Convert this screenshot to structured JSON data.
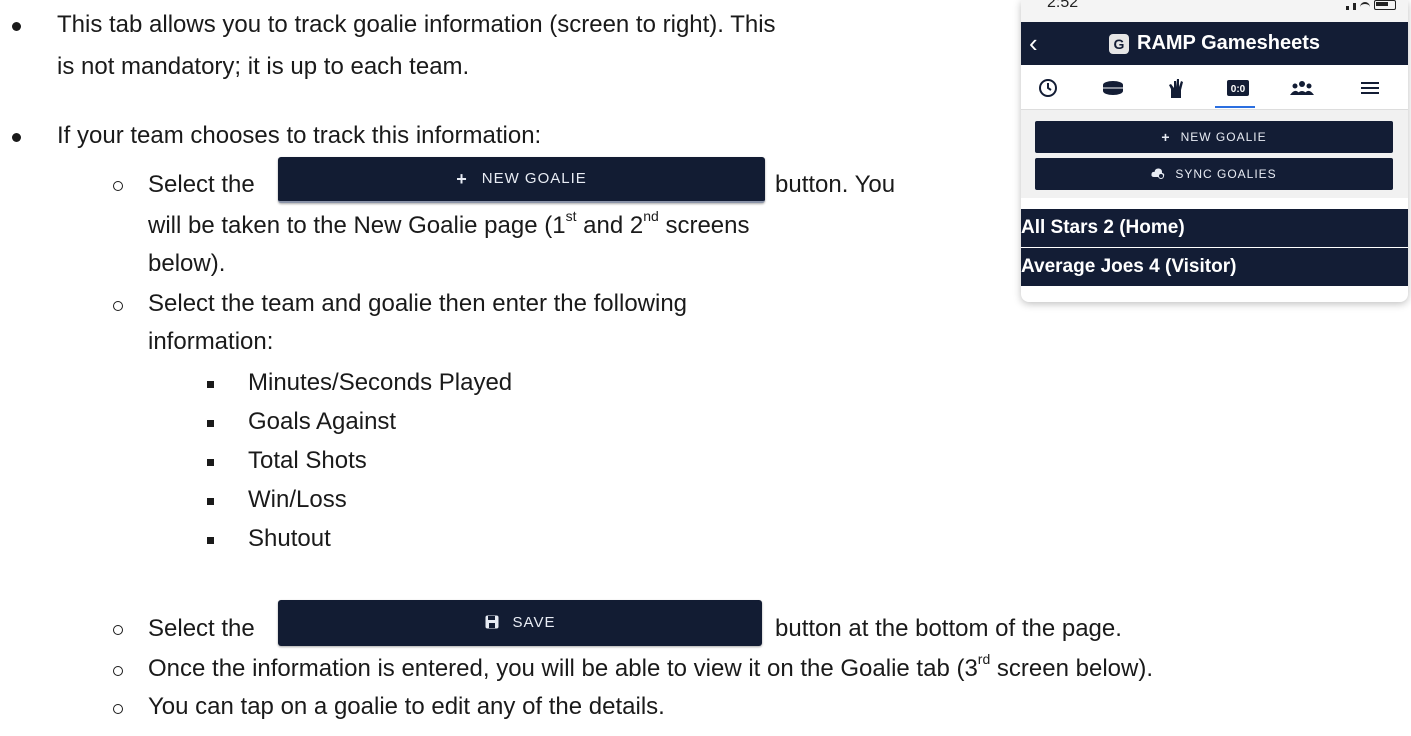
{
  "doc": {
    "bullet1_line1": "This tab allows you to track goalie information (screen to right). This",
    "bullet1_line2": "is not mandatory; it is up to each team.",
    "bullet2": "If your team chooses to track this information:",
    "sub1_pre": "Select the",
    "sub1_post": "button. You",
    "sub1_line2_a": "will be taken to the New Goalie page (1",
    "sub1_sup1": "st",
    "sub1_line2_b": " and 2",
    "sub1_sup2": "nd",
    "sub1_line2_c": " screens",
    "sub1_line3": "below).",
    "sub2_line1": "Select the team and goalie then enter the following",
    "sub2_line2": "information:",
    "fields": [
      "Minutes/Seconds Played",
      "Goals Against",
      "Total Shots",
      "Win/Loss",
      "Shutout"
    ],
    "sub3_pre": "Select the",
    "sub3_post": "button at the bottom of the page.",
    "sub4_a": "Once the information is entered, you will be able to view it on the Goalie tab (3",
    "sub4_sup": "rd",
    "sub4_b": " screen below).",
    "sub5": "You can tap on a goalie to edit any of the details."
  },
  "inline_buttons": {
    "new_goalie_label": "NEW GOALIE",
    "new_goalie_icon": "+",
    "save_label": "SAVE",
    "save_icon_name": "save-icon"
  },
  "phone": {
    "time": "2:52",
    "title": "RAMP Gamesheets",
    "logo_letter": "G",
    "tabs": [
      "clock-icon",
      "puck-icon",
      "hand-icon",
      "scoreboard-icon",
      "people-icon",
      "menu-icon"
    ],
    "active_tab": 3,
    "new_goalie_label": "NEW GOALIE",
    "sync_goalies_label": "SYNC GOALIES",
    "teams": [
      "All Stars 2 (Home)",
      "Average Joes 4 (Visitor)"
    ]
  },
  "colors": {
    "navy": "#131d35",
    "accent": "#2b6fe0"
  }
}
